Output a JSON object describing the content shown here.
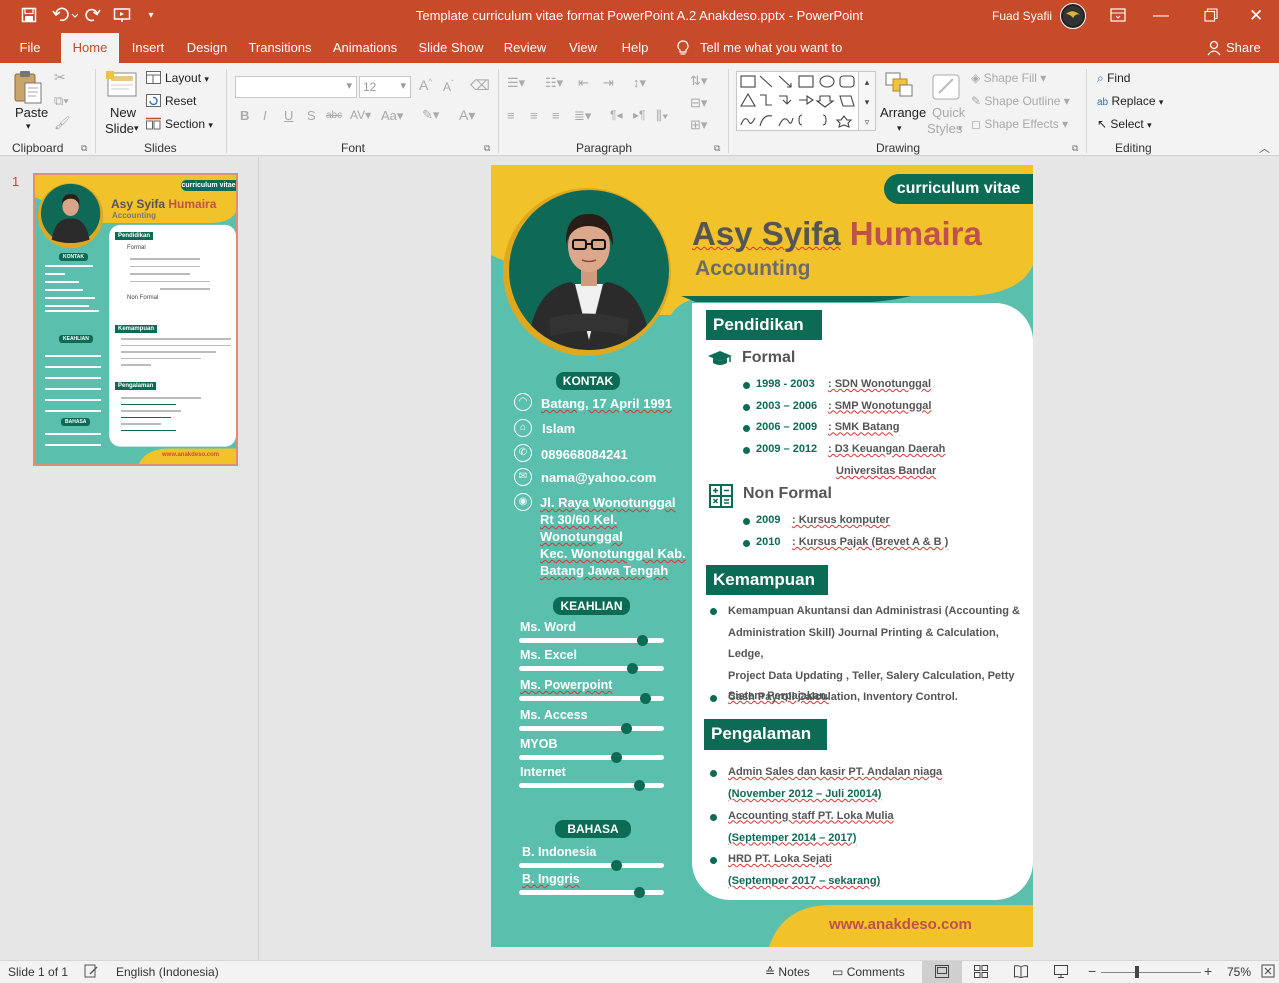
{
  "app": {
    "window_title": "Template curriculum vitae format PowerPoint A.2  Anakdeso.pptx  -  PowerPoint",
    "user_name": "Fuad Syafii",
    "colors": {
      "accent": "#c74a29",
      "slide_teal": "#5bbfae",
      "slide_green": "#0c6b55",
      "slide_yellow": "#f2c22a",
      "name_red": "#c0504d"
    }
  },
  "tabs": [
    "File",
    "Home",
    "Insert",
    "Design",
    "Transitions",
    "Animations",
    "Slide Show",
    "Review",
    "View",
    "Help"
  ],
  "tell_me": "Tell me what you want to do",
  "share_label": "Share",
  "ribbon": {
    "clipboard": {
      "paste": "Paste",
      "label": "Clipboard"
    },
    "slides": {
      "new_slide_line1": "New",
      "new_slide_line2": "Slide",
      "layout": "Layout",
      "reset": "Reset",
      "section": "Section",
      "label": "Slides"
    },
    "font": {
      "size": "12",
      "label": "Font"
    },
    "paragraph": {
      "label": "Paragraph"
    },
    "drawing": {
      "arrange": "Arrange",
      "quick_styles_line1": "Quick",
      "quick_styles_line2": "Styles",
      "shape_fill": "Shape Fill",
      "shape_outline": "Shape Outline",
      "shape_effects": "Shape Effects",
      "label": "Drawing"
    },
    "editing": {
      "find": "Find",
      "replace": "Replace",
      "select": "Select",
      "label": "Editing"
    }
  },
  "thumbnail": {
    "number": "1"
  },
  "slide": {
    "badge": "curriculum vitae",
    "first_name": "Asy Syifa",
    "last_name": "Humaira",
    "role": "Accounting",
    "kontak": {
      "title": "KONTAK",
      "birth": "Batang, 17 April 1991",
      "religion": "Islam",
      "phone": "089668084241",
      "email": "nama@yahoo.com",
      "address": [
        "Jl. Raya Wonotunggal",
        "Rt 30/60 Kel.",
        "Wonotunggal",
        "Kec. Wonotunggal Kab.",
        "Batang Jawa Tengah"
      ]
    },
    "keahlian": {
      "title": "KEAHLIAN",
      "skills": [
        {
          "name": "Ms. Word",
          "level": 0.85
        },
        {
          "name": "Ms. Excel",
          "level": 0.78
        },
        {
          "name": "Ms. Powerpoint",
          "level": 0.87
        },
        {
          "name": "Ms. Access",
          "level": 0.74
        },
        {
          "name": "MYOB",
          "level": 0.67
        },
        {
          "name": "Internet",
          "level": 0.83
        }
      ]
    },
    "bahasa": {
      "title": "BAHASA",
      "langs": [
        {
          "name": "B. Indonesia",
          "level": 0.67
        },
        {
          "name": "B. Inggris",
          "level": 0.83
        }
      ]
    },
    "pendidikan": {
      "title": "Pendidikan",
      "formal_title": "Formal",
      "formal": [
        {
          "year": "1998 - 2003",
          "school": ": SDN Wonotunggal"
        },
        {
          "year": "2003 – 2006",
          "school": ": SMP Wonotunggal"
        },
        {
          "year": "2006 – 2009",
          "school": ": SMK Batang"
        },
        {
          "year": "2009 – 2012",
          "school": ": D3 Keuangan Daerah"
        }
      ],
      "formal_extra": "Universitas Bandar",
      "nonformal_title": "Non Formal",
      "nonformal": [
        {
          "year": "2009",
          "course": ": Kursus komputer"
        },
        {
          "year": "2010",
          "course": ": Kursus Pajak (Brevet A & B )"
        }
      ]
    },
    "kemampuan": {
      "title": "Kemampuan",
      "items": [
        [
          "Kemampuan Akuntansi dan Administrasi (Accounting &",
          "Administration Skill) Journal Printing & Calculation, Ledge,",
          "Project Data Updating , Teller, Salery Calculation, Petty",
          "Cash Payroll Calculation, Inventory Control."
        ],
        [
          "Sistem Perpajakan."
        ]
      ]
    },
    "pengalaman": {
      "title": "Pengalaman",
      "items": [
        {
          "job": "Admin Sales dan kasir PT. Andalan niaga",
          "period": "(November 2012 – Juli 20014)"
        },
        {
          "job": "Accounting staff PT. Loka Mulia",
          "period": "(Septemper 2014 – 2017)"
        },
        {
          "job": "HRD PT. Loka Sejati",
          "period": "(Septemper 2017 – sekarang)"
        }
      ]
    },
    "website": "www.anakdeso.com"
  },
  "thumb_text": {
    "thumb_badge": "curriculum vitae",
    "thumb_first": "Asy Syifa",
    "thumb_last": "Humaira",
    "thumb_role": "Accounting",
    "thumb_kontak": "KONTAK",
    "thumb_keahlian": "KEAHLIAN",
    "thumb_bahasa": "BAHASA",
    "thumb_pendidikan": "Pendidikan",
    "thumb_formal": "Formal",
    "thumb_nonformal": "Non Formal",
    "thumb_kemampuan": "Kemampuan",
    "thumb_pengalaman": "Pengalaman",
    "thumb_web": "www.anakdeso.com"
  },
  "status": {
    "slide_of": "Slide 1 of 1",
    "language": "English (Indonesia)",
    "notes": "Notes",
    "comments": "Comments",
    "zoom": "75%"
  }
}
